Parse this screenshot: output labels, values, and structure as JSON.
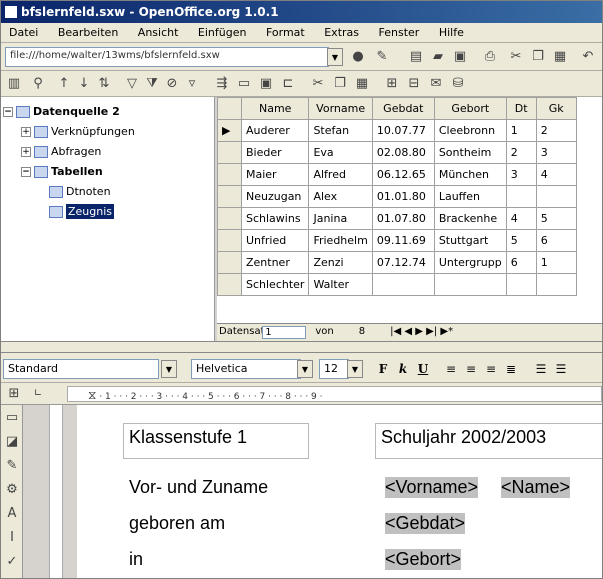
{
  "window": {
    "title": "bfslernfeld.sxw - OpenOffice.org 1.0.1"
  },
  "menu": [
    "Datei",
    "Bearbeiten",
    "Ansicht",
    "Einfügen",
    "Format",
    "Extras",
    "Fenster",
    "Hilfe"
  ],
  "url": {
    "value": "file:///home/walter/13wms/bfslernfeld.sxw"
  },
  "tree": {
    "root": "Datenquelle 2",
    "items": [
      "Verknüpfungen",
      "Abfragen",
      "Tabellen",
      "Dtnoten",
      "Zeugnis"
    ]
  },
  "table": {
    "columns": [
      "Name",
      "Vorname",
      "Gebdat",
      "Gebort",
      "Dt",
      "Gk"
    ],
    "rows": [
      [
        "Auderer",
        "Stefan",
        "10.07.77",
        "Cleebronn",
        "1",
        "2"
      ],
      [
        "Bieder",
        "Eva",
        "02.08.80",
        "Sontheim",
        "2",
        "3"
      ],
      [
        "Maier",
        "Alfred",
        "06.12.65",
        "München",
        "3",
        "4"
      ],
      [
        "Neuzugan",
        "Alex",
        "01.01.80",
        "Lauffen",
        "",
        ""
      ],
      [
        "Schlawins",
        "Janina",
        "01.07.80",
        "Brackenhe",
        "4",
        "5"
      ],
      [
        "Unfried",
        "Friedhelm",
        "09.11.69",
        "Stuttgart",
        "5",
        "6"
      ],
      [
        "Zentner",
        "Zenzi",
        "07.12.74",
        "Untergrupp",
        "6",
        "1"
      ],
      [
        "Schlechter",
        "Walter",
        "",
        "",
        "",
        ""
      ]
    ]
  },
  "nav": {
    "label": "Datensatz",
    "current": "1",
    "of": "von",
    "count": "8"
  },
  "format": {
    "style": "Standard",
    "font": "Helvetica",
    "size": "12",
    "bold": "F",
    "italic": "k",
    "underline": "U"
  },
  "ruler": {
    "ticks": "· 1 · · · 2 · · · 3 · · · 4 · · · 5 · · · 6 · · · 7 · · · 8 · · · 9 ·"
  },
  "document": {
    "klassenstufe": "Klassenstufe 1",
    "schuljahr": "Schuljahr  2002/2003",
    "vorname_label": "Vor- und Zuname",
    "vorname_ph": "<Vorname>",
    "name_ph": "<Name>",
    "geboren_label": "geboren am",
    "gebdat_ph": "<Gebdat>",
    "in_label": "in",
    "gebort_ph": "<Gebort>"
  }
}
